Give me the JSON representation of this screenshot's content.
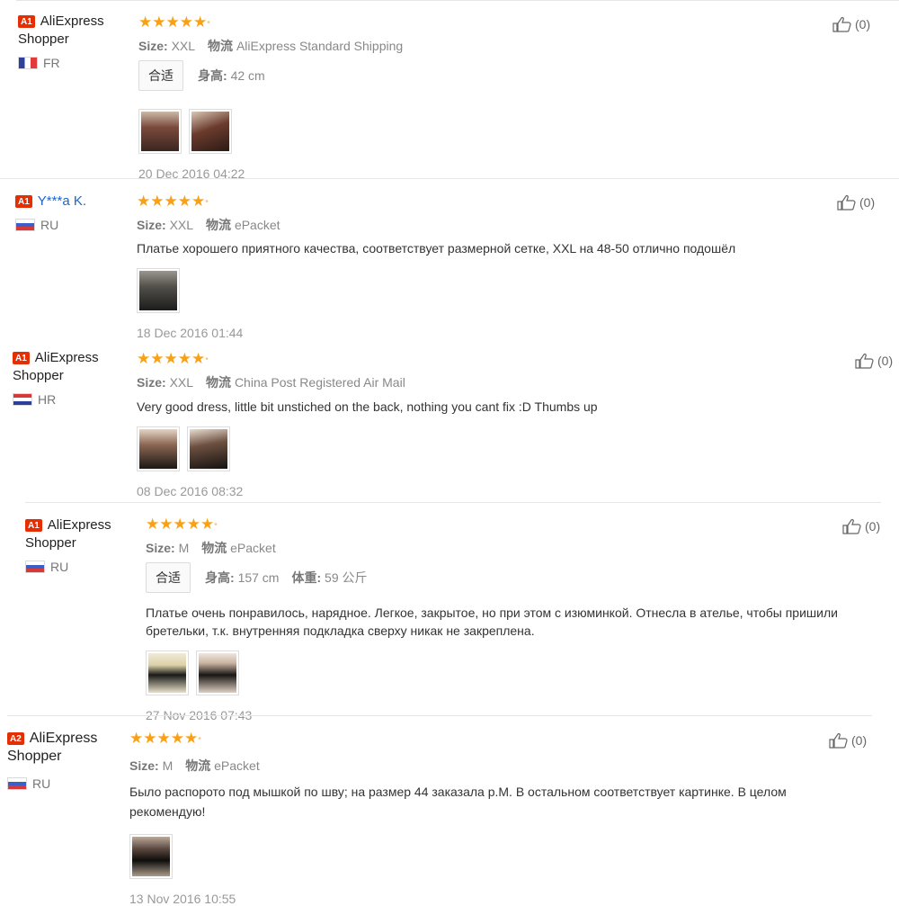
{
  "labels": {
    "size": "Size:",
    "shipping": "物流",
    "fit": "合适",
    "height": "身高:",
    "weight": "体重:"
  },
  "reviews": [
    {
      "badge": "A1",
      "name_line1": "AliExpress",
      "name_line2": "Shopper",
      "country": "FR",
      "flag": "fr",
      "rating": 5,
      "size": "XXL",
      "shipping": "AliExpress Standard Shipping",
      "height": "42 cm",
      "date": "20 Dec 2016 04:22",
      "likes": "(0)"
    },
    {
      "badge": "A1",
      "name": "Y***a K.",
      "country": "RU",
      "flag": "ru",
      "rating": 5,
      "size": "XXL",
      "shipping": "ePacket",
      "text": "Платье хорошего приятного качества, соответствует размерной сетке, XXL на 48-50 отлично подошёл",
      "date": "18 Dec 2016 01:44",
      "likes": "(0)"
    },
    {
      "badge": "A1",
      "name_line1": "AliExpress",
      "name_line2": "Shopper",
      "country": "HR",
      "flag": "hr",
      "rating": 5,
      "size": "XXL",
      "shipping": "China Post Registered Air Mail",
      "text": "Very good dress, little bit unstiched on the back, nothing you cant fix :D Thumbs up",
      "date": "08 Dec 2016 08:32",
      "likes": "(0)"
    },
    {
      "badge": "A1",
      "name_line1": "AliExpress",
      "name_line2": "Shopper",
      "country": "RU",
      "flag": "ru",
      "rating": 5,
      "size": "M",
      "shipping": "ePacket",
      "height": "157 cm",
      "weight": "59 公斤",
      "text": "Платье очень понравилось, нарядное. Легкое, закрытое, но при этом с изюминкой. Отнесла в ателье, чтобы пришили бретельки, т.к. внутренняя подкладка сверху никак не закреплена.",
      "date": "27 Nov 2016 07:43",
      "likes": "(0)"
    },
    {
      "badge": "A2",
      "name_line1": "AliExpress",
      "name_line2": "Shopper",
      "country": "RU",
      "flag": "ru",
      "rating": 5,
      "size": "M",
      "shipping": "ePacket",
      "text": "Было распорото под мышкой по шву; на размер 44 заказала р.М. В остальном соответствует картинке. В целом рекомендую!",
      "date": "13 Nov 2016 10:55",
      "likes": "(0)"
    }
  ]
}
